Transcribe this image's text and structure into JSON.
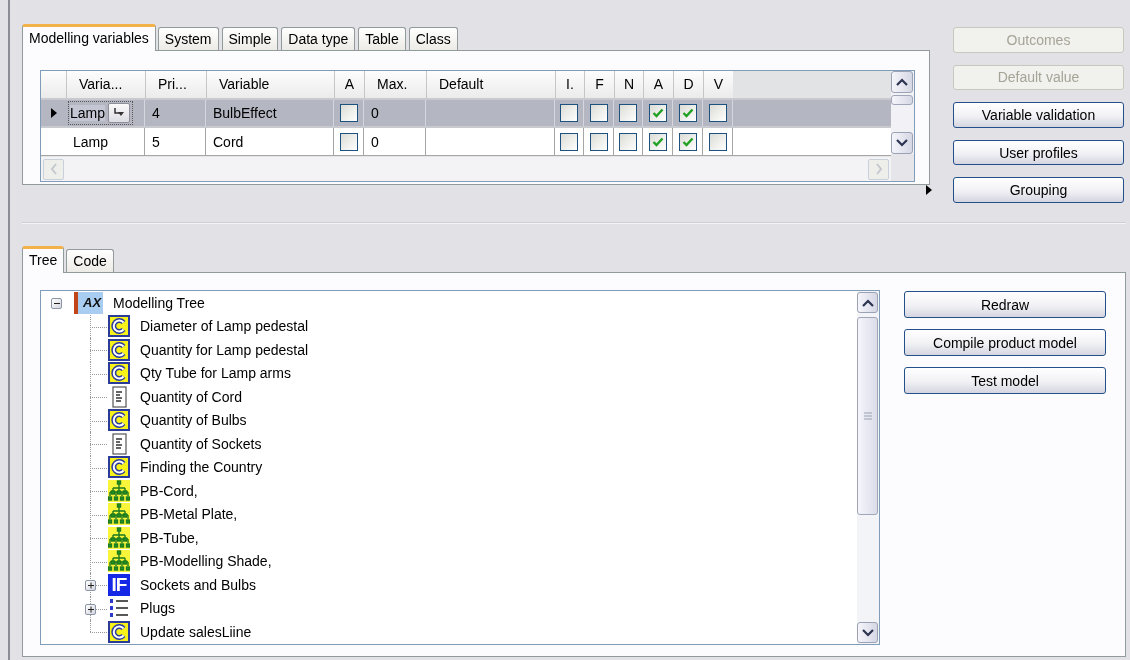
{
  "top_tabs": [
    {
      "label": "Modelling variables",
      "selected": true
    },
    {
      "label": "System",
      "selected": false
    },
    {
      "label": "Simple",
      "selected": false
    },
    {
      "label": "Data type",
      "selected": false
    },
    {
      "label": "Table",
      "selected": false
    },
    {
      "label": "Class",
      "selected": false
    }
  ],
  "grid": {
    "columns": [
      "Varia...",
      "Pri...",
      "Variable",
      "A",
      "Max.",
      "Default",
      "I.",
      "F",
      "N",
      "A",
      "D",
      "V"
    ],
    "rows": [
      {
        "selected": true,
        "cells": [
          {
            "kind": "combo",
            "value": "Lamp",
            "editing": true
          },
          {
            "kind": "text",
            "value": "4"
          },
          {
            "kind": "text",
            "value": "BulbEffect"
          },
          {
            "kind": "check",
            "checked": false
          },
          {
            "kind": "text",
            "value": "0"
          },
          {
            "kind": "blank"
          },
          {
            "kind": "check",
            "checked": false
          },
          {
            "kind": "check",
            "checked": false
          },
          {
            "kind": "check",
            "checked": false
          },
          {
            "kind": "check",
            "checked": true
          },
          {
            "kind": "check",
            "checked": true
          },
          {
            "kind": "check",
            "checked": false
          }
        ]
      },
      {
        "selected": false,
        "cells": [
          {
            "kind": "combo",
            "value": "Lamp",
            "editing": false
          },
          {
            "kind": "text",
            "value": "5"
          },
          {
            "kind": "text",
            "value": "Cord"
          },
          {
            "kind": "check",
            "checked": false
          },
          {
            "kind": "text",
            "value": "0"
          },
          {
            "kind": "blank"
          },
          {
            "kind": "check",
            "checked": false
          },
          {
            "kind": "check",
            "checked": false
          },
          {
            "kind": "check",
            "checked": false
          },
          {
            "kind": "check",
            "checked": true
          },
          {
            "kind": "check",
            "checked": true
          },
          {
            "kind": "check",
            "checked": false
          }
        ]
      }
    ]
  },
  "top_buttons": [
    {
      "label": "Outcomes",
      "disabled": true
    },
    {
      "label": "Default value",
      "disabled": true
    },
    {
      "label": "Variable validation",
      "disabled": false
    },
    {
      "label": "User profiles",
      "disabled": false
    },
    {
      "label": "Grouping",
      "disabled": false
    }
  ],
  "bottom_tabs": [
    {
      "label": "Tree",
      "selected": true
    },
    {
      "label": "Code",
      "selected": false
    }
  ],
  "tree": {
    "items": [
      {
        "label": "Modelling Tree",
        "kind": "ax",
        "badge": "AX",
        "expanded": true,
        "children": [
          {
            "label": "Diameter of Lamp pedestal",
            "kind": "calc"
          },
          {
            "label": "Quantity for Lamp pedestal",
            "kind": "calc"
          },
          {
            "label": "Qty Tube for Lamp arms",
            "kind": "calc"
          },
          {
            "label": "Quantity of Cord",
            "kind": "doc"
          },
          {
            "label": "Quantity of Bulbs",
            "kind": "calc"
          },
          {
            "label": "Quantity of Sockets",
            "kind": "doc"
          },
          {
            "label": "Finding the Country",
            "kind": "calc"
          },
          {
            "label": "PB-Cord,",
            "kind": "pb"
          },
          {
            "label": "PB-Metal Plate,",
            "kind": "pb"
          },
          {
            "label": "PB-Tube,",
            "kind": "pb"
          },
          {
            "label": "PB-Modelling Shade,",
            "kind": "pb"
          },
          {
            "label": "Sockets and Bulbs",
            "kind": "if",
            "badge": "IF",
            "expanded": false
          },
          {
            "label": "Plugs",
            "kind": "list",
            "expanded": false
          },
          {
            "label": "Update salesLiine",
            "kind": "calc"
          }
        ]
      }
    ]
  },
  "bottom_buttons": [
    {
      "label": "Redraw",
      "disabled": false
    },
    {
      "label": "Compile product model",
      "disabled": false
    },
    {
      "label": "Test model",
      "disabled": false
    }
  ]
}
